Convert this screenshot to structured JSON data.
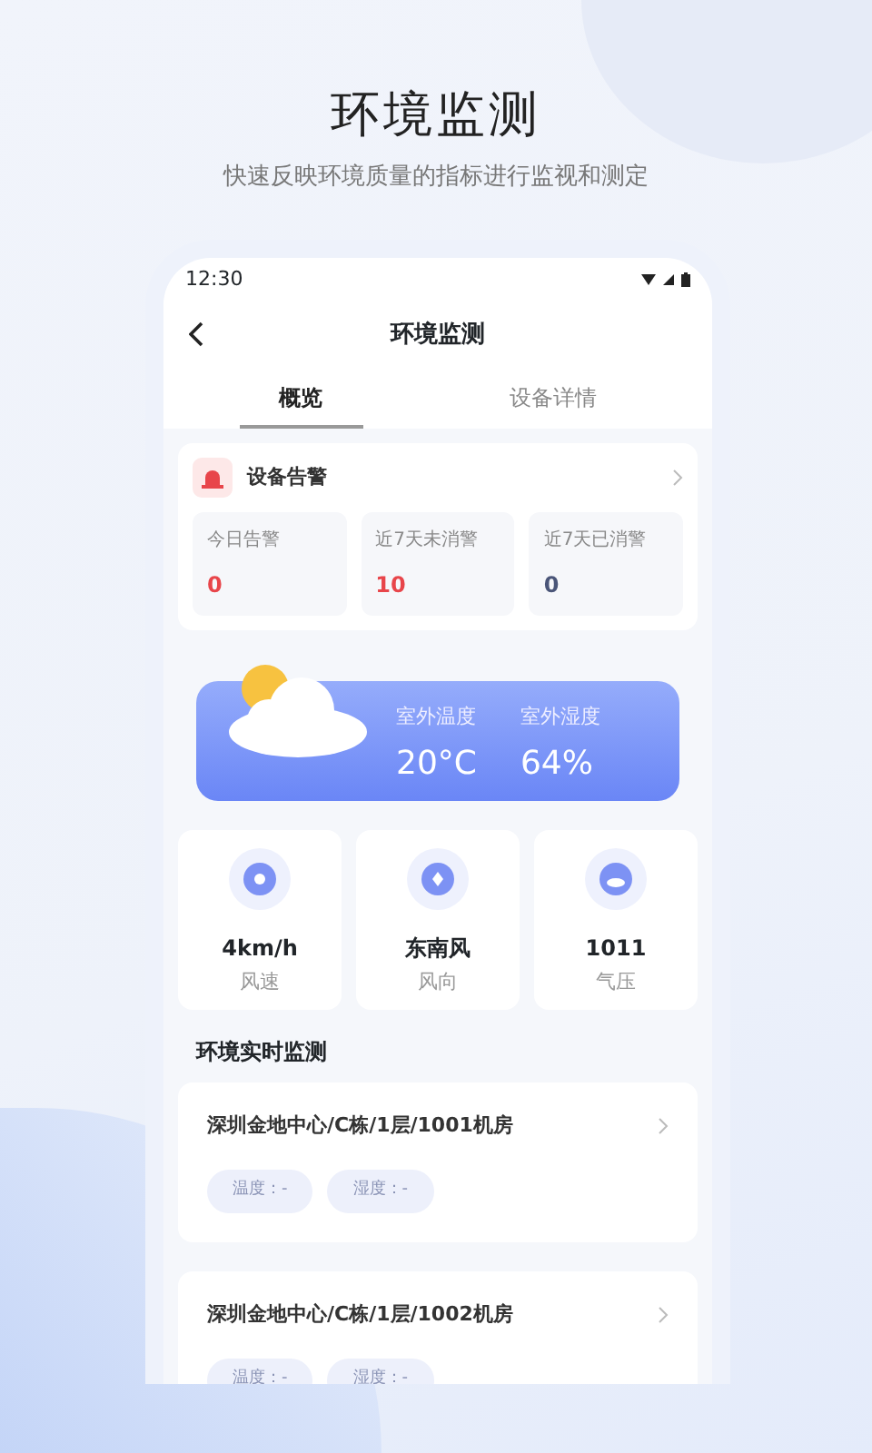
{
  "headline": "环境监测",
  "subtitle": "快速反映环境质量的指标进行监视和测定",
  "status_bar": {
    "time": "12:30"
  },
  "nav": {
    "title": "环境监测"
  },
  "tabs": [
    {
      "label": "概览",
      "selected": true
    },
    {
      "label": "设备详情",
      "selected": false
    }
  ],
  "alarm": {
    "title": "设备告警",
    "stats": [
      {
        "label": "今日告警",
        "value": "0",
        "color": "#e8454a"
      },
      {
        "label": "近7天未消警",
        "value": "10",
        "color": "#e8454a"
      },
      {
        "label": "近7天已消警",
        "value": "0",
        "color": "#4a5578"
      }
    ]
  },
  "weather": [
    {
      "label": "室外温度",
      "value": "20°C"
    },
    {
      "label": "室外湿度",
      "value": "64%"
    }
  ],
  "metrics": [
    {
      "kind": "sun",
      "value": "4km/h",
      "label": "风速"
    },
    {
      "kind": "fan",
      "value": "东南风",
      "label": "风向"
    },
    {
      "kind": "cloud",
      "value": "1011",
      "label": "气压"
    }
  ],
  "section_title": "环境实时监测",
  "rooms": [
    {
      "name": "深圳金地中心/C栋/1层/1001机房",
      "tags": [
        "温度：-",
        "湿度：-"
      ]
    },
    {
      "name": "深圳金地中心/C栋/1层/1002机房",
      "tags": [
        "温度：-",
        "湿度：-"
      ]
    }
  ]
}
